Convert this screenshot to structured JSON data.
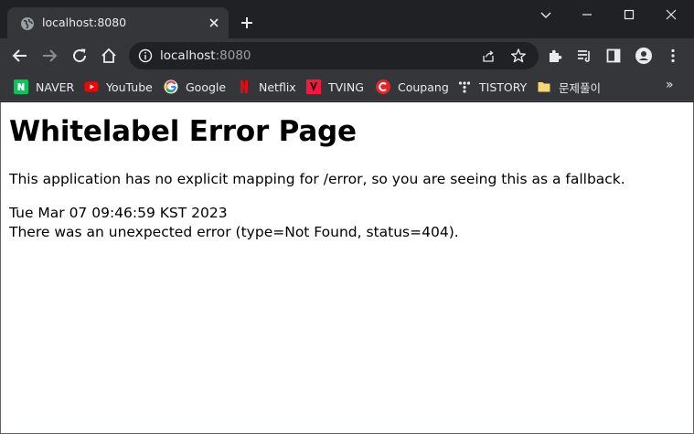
{
  "browser": {
    "tab": {
      "title": "localhost:8080",
      "favicon": "globe-icon"
    },
    "omnibox": {
      "host": "localhost",
      "port": ":8080"
    },
    "bookmarks": [
      {
        "label": "NAVER",
        "icon": "naver-icon",
        "color": "#03c75a"
      },
      {
        "label": "YouTube",
        "icon": "youtube-icon",
        "color": "#ff0000"
      },
      {
        "label": "Google",
        "icon": "google-icon",
        "color": "#4285f4"
      },
      {
        "label": "Netflix",
        "icon": "netflix-icon",
        "color": "#e50914"
      },
      {
        "label": "TVING",
        "icon": "tving-icon",
        "color": "#ff153c"
      },
      {
        "label": "Coupang",
        "icon": "coupang-icon",
        "color": "#e52528"
      },
      {
        "label": "TISTORY",
        "icon": "tistory-icon",
        "color": "#333333"
      },
      {
        "label": "문제풀이",
        "icon": "folder-icon",
        "color": "#f7d774"
      }
    ],
    "more_bookmarks": "»"
  },
  "page": {
    "title": "Whitelabel Error Page",
    "message": "This application has no explicit mapping for /error, so you are seeing this as a fallback.",
    "timestamp": "Tue Mar 07 09:46:59 KST 2023",
    "error": "There was an unexpected error (type=Not Found, status=404)."
  }
}
